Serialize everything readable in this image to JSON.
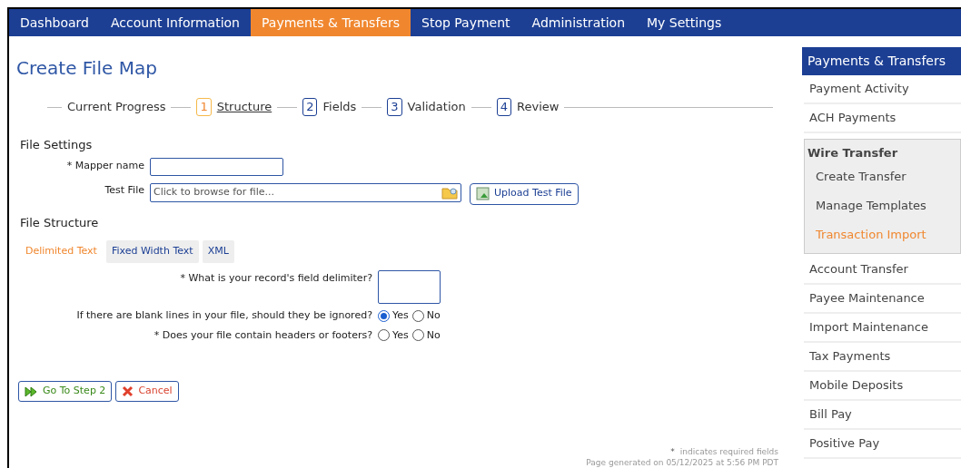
{
  "nav": [
    {
      "label": "Dashboard",
      "selected": false
    },
    {
      "label": "Account Information",
      "selected": false
    },
    {
      "label": "Payments & Transfers",
      "selected": true
    },
    {
      "label": "Stop Payment",
      "selected": false
    },
    {
      "label": "Administration",
      "selected": false
    },
    {
      "label": "My Settings",
      "selected": false
    }
  ],
  "page_title": "Create File Map",
  "progress": {
    "label": "Current Progress",
    "steps": [
      {
        "number": "1",
        "label": "Structure",
        "selected": true
      },
      {
        "number": "2",
        "label": "Fields",
        "selected": false
      },
      {
        "number": "3",
        "label": "Validation",
        "selected": false
      },
      {
        "number": "4",
        "label": "Review",
        "selected": false
      }
    ]
  },
  "file_settings": {
    "heading": "File Settings",
    "mapper_label": "* Mapper name",
    "test_file_label": "Test File",
    "test_file_placeholder": "Click to browse for file...",
    "upload_button": "Upload Test File"
  },
  "file_structure": {
    "heading": "File Structure",
    "tabs": [
      {
        "label": "Delimited Text",
        "selected": true
      },
      {
        "label": "Fixed Width Text",
        "selected": false
      },
      {
        "label": "XML",
        "selected": false
      }
    ],
    "delimiter_label": "* What is your record's field delimiter?",
    "questions": [
      {
        "label": "If there are blank lines in your file, should they be ignored?",
        "options": [
          {
            "label": "Yes",
            "selected": true
          },
          {
            "label": "No",
            "selected": false
          }
        ]
      },
      {
        "label": "* Does your file contain headers or footers?",
        "options": [
          {
            "label": "Yes",
            "selected": false
          },
          {
            "label": "No",
            "selected": false
          }
        ]
      }
    ]
  },
  "buttons": {
    "next": "Go To Step 2",
    "cancel": "Cancel"
  },
  "footer": {
    "required_mark": "*",
    "required_note": "indicates required fields",
    "generated": "Page generated on 05/12/2025 at 5:56 PM PDT"
  },
  "sidebar": {
    "title": "Payments & Transfers",
    "items": [
      {
        "label": "Payment Activity"
      },
      {
        "label": "ACH Payments"
      },
      {
        "label": "Wire Transfer",
        "children": [
          {
            "label": "Create Transfer",
            "selected": false
          },
          {
            "label": "Manage Templates",
            "selected": false
          },
          {
            "label": "Transaction Import",
            "selected": true
          }
        ]
      },
      {
        "label": "Account Transfer"
      },
      {
        "label": "Payee Maintenance"
      },
      {
        "label": "Import Maintenance"
      },
      {
        "label": "Tax Payments"
      },
      {
        "label": "Mobile Deposits"
      },
      {
        "label": "Bill Pay"
      },
      {
        "label": "Positive Pay"
      }
    ]
  }
}
